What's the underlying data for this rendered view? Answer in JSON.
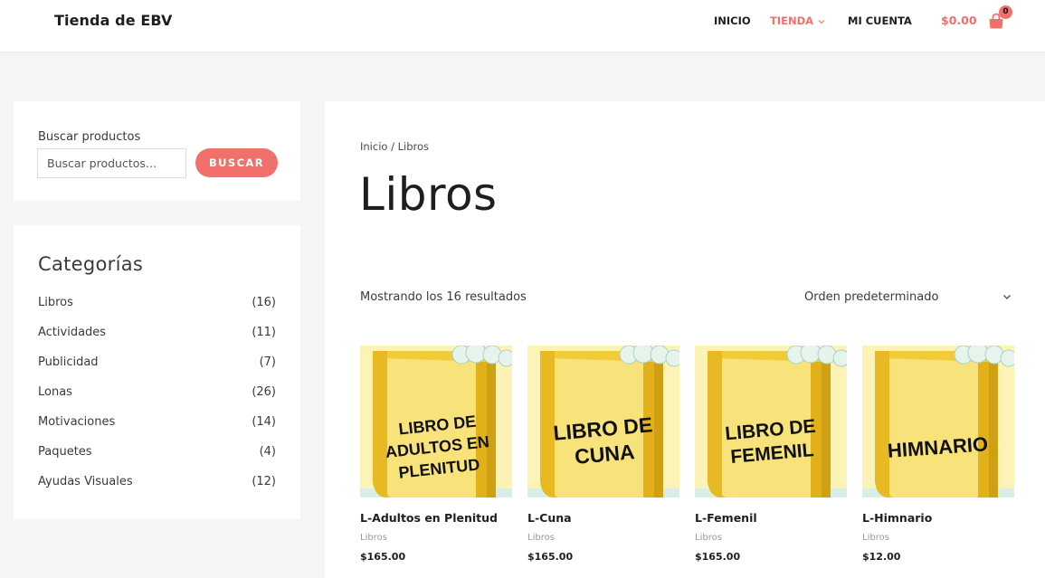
{
  "header": {
    "brand": "Tienda de EBV",
    "nav": [
      {
        "label": "INICIO"
      },
      {
        "label": "TIENDA"
      },
      {
        "label": "MI CUENTA"
      }
    ],
    "cart_total": "$0.00",
    "cart_count": "0",
    "accent_color": "#f2706b"
  },
  "sidebar": {
    "search": {
      "title": "Buscar productos",
      "placeholder": "Buscar productos…",
      "button_label": "BUSCAR"
    },
    "categories": {
      "title": "Categorías",
      "items": [
        {
          "name": "Libros",
          "count": "(16)"
        },
        {
          "name": "Actividades",
          "count": "(11)"
        },
        {
          "name": "Publicidad",
          "count": "(7)"
        },
        {
          "name": "Lonas",
          "count": "(26)"
        },
        {
          "name": "Motivaciones",
          "count": "(14)"
        },
        {
          "name": "Paquetes",
          "count": "(4)"
        },
        {
          "name": "Ayudas Visuales",
          "count": "(12)"
        }
      ]
    }
  },
  "main": {
    "breadcrumb": "Inicio / Libros",
    "page_title": "Libros",
    "result_count": "Mostrando los 16 resultados",
    "sort_selected": "Orden predeterminado",
    "products": [
      {
        "name": "L-Adultos en Plenitud",
        "category": "Libros",
        "price": "$165.00",
        "cover_lines": [
          "LIBRO DE",
          "ADULTOS EN",
          "PLENITUD"
        ]
      },
      {
        "name": "L-Cuna",
        "category": "Libros",
        "price": "$165.00",
        "cover_lines": [
          "LIBRO DE",
          "CUNA"
        ]
      },
      {
        "name": "L-Femenil",
        "category": "Libros",
        "price": "$165.00",
        "cover_lines": [
          "LIBRO DE",
          "FEMENIL"
        ]
      },
      {
        "name": "L-Himnario",
        "category": "Libros",
        "price": "$12.00",
        "cover_lines": [
          "HIMNARIO"
        ]
      }
    ]
  }
}
